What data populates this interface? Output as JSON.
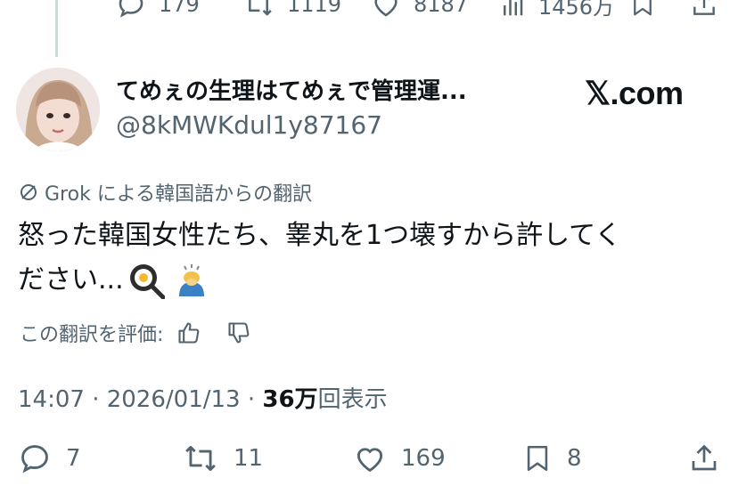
{
  "prev_tweet": {
    "actions": {
      "replies": "179",
      "retweets": "1119",
      "likes": "8187",
      "views": "1456万"
    }
  },
  "tweet": {
    "display_name": "てめぇの生理はてめぇで管理運...",
    "handle": "@8kMWKdul1y87167",
    "watermark": "𝕏.com",
    "translation_note": "Grok による韓国語からの翻訳",
    "text_line1": "怒った韓国女性たち、睾丸を1つ壊すから許してく",
    "text_line2": "ださい...",
    "rate_label": "この翻訳を評価:",
    "timestamp": "14:07 · 2026/01/13 · ",
    "view_count": "36万",
    "view_suffix": "回表示",
    "actions": {
      "replies": "7",
      "retweets": "11",
      "likes": "169",
      "bookmarks": "8"
    }
  }
}
